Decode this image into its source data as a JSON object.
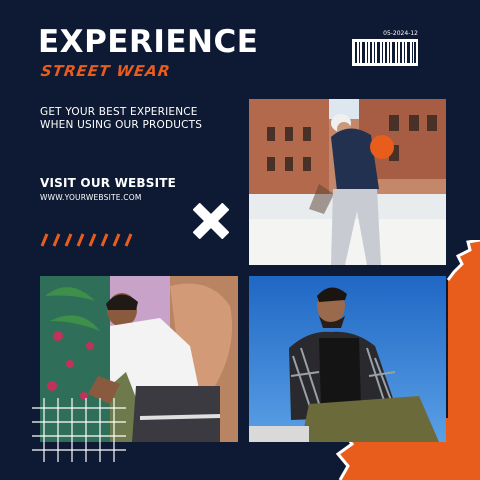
{
  "header": {
    "title": "EXPERIENCE",
    "subtitle": "STREET WEAR"
  },
  "barcode": {
    "date": "05-2024-12"
  },
  "tagline": {
    "line1": "GET YOUR BEST EXPERIENCE",
    "line2": "WHEN USING OUR PRODUCTS"
  },
  "cta": {
    "heading": "VISIT OUR WEBSITE",
    "url": "WWW.YOURWEBSITE.COM"
  },
  "colors": {
    "background": "#0e1a33",
    "accent": "#e85c1c",
    "text": "#ffffff"
  },
  "decor": {
    "slashes_icon": "slash-stripes-icon",
    "cross_icon": "x-cross-icon",
    "grid_icon": "grid-lines-icon"
  }
}
